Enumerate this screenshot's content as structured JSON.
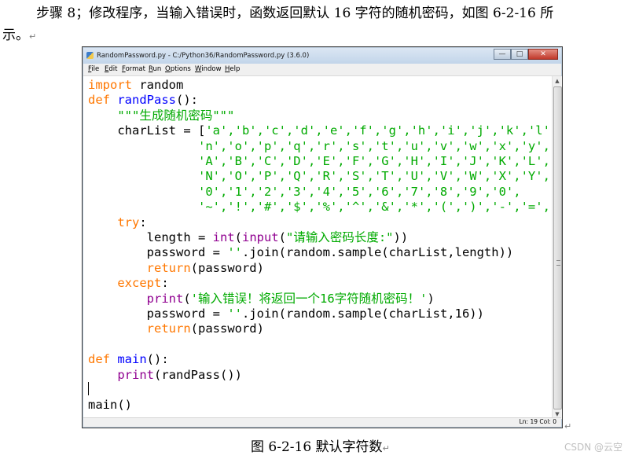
{
  "paragraph": {
    "line1": "步骤 8；修改程序，当输入错误时，函数返回默认 16 字符的随机密码，如图 6-2-16 所",
    "line2": "示。"
  },
  "paragraph_mark": "↵",
  "window": {
    "title": "RandomPassword.py - C:/Python36/RandomPassword.py (3.6.0)",
    "btn_min": "—",
    "btn_max": "□",
    "btn_close": "✕",
    "menu": [
      "File",
      "Edit",
      "Format",
      "Run",
      "Options",
      "Window",
      "Help"
    ],
    "status": "Ln: 19  Col: 0"
  },
  "code": [
    [
      {
        "t": "import",
        "c": "kw"
      },
      {
        "t": " random"
      }
    ],
    [
      {
        "t": "def",
        "c": "kw"
      },
      {
        "t": " "
      },
      {
        "t": "randPass",
        "c": "def"
      },
      {
        "t": "():"
      }
    ],
    [
      {
        "t": "    "
      },
      {
        "t": "\"\"\"生成随机密码\"\"\"",
        "c": "str"
      }
    ],
    [
      {
        "t": "    charList = ["
      },
      {
        "t": "'a','b','c','d','e','f','g','h','i','j','k','l','m',",
        "c": "str"
      }
    ],
    [
      {
        "t": "               "
      },
      {
        "t": "'n','o','p','q','r','s','t','u','v','w','x','y','z',",
        "c": "str"
      }
    ],
    [
      {
        "t": "               "
      },
      {
        "t": "'A','B','C','D','E','F','G','H','I','J','K','L','M',",
        "c": "str"
      }
    ],
    [
      {
        "t": "               "
      },
      {
        "t": "'N','O','P','Q','R','S','T','U','V','W','X','Y','Z',",
        "c": "str"
      }
    ],
    [
      {
        "t": "               "
      },
      {
        "t": "'0','1','2','3','4','5','6','7','8','9','0',",
        "c": "str"
      }
    ],
    [
      {
        "t": "               "
      },
      {
        "t": "'~','!','#','$','%','^','&','*','(',')','-','=','+',",
        "c": "str"
      }
    ],
    [
      {
        "t": "    "
      },
      {
        "t": "try",
        "c": "kw"
      },
      {
        "t": ":"
      }
    ],
    [
      {
        "t": "        length = "
      },
      {
        "t": "int",
        "c": "bi"
      },
      {
        "t": "("
      },
      {
        "t": "input",
        "c": "bi"
      },
      {
        "t": "("
      },
      {
        "t": "\"请输入密码长度:\"",
        "c": "str"
      },
      {
        "t": "))"
      }
    ],
    [
      {
        "t": "        password = "
      },
      {
        "t": "''",
        "c": "str"
      },
      {
        "t": ".join(random.sample(charList,length))"
      }
    ],
    [
      {
        "t": "        "
      },
      {
        "t": "return",
        "c": "kw"
      },
      {
        "t": "(password)"
      }
    ],
    [
      {
        "t": "    "
      },
      {
        "t": "except",
        "c": "kw"
      },
      {
        "t": ":"
      }
    ],
    [
      {
        "t": "        "
      },
      {
        "t": "print",
        "c": "bi"
      },
      {
        "t": "("
      },
      {
        "t": "'输入错误！将返回一个16字符随机密码！'",
        "c": "str"
      },
      {
        "t": ")"
      }
    ],
    [
      {
        "t": "        password = "
      },
      {
        "t": "''",
        "c": "str"
      },
      {
        "t": ".join(random.sample(charList,16))"
      }
    ],
    [
      {
        "t": "        "
      },
      {
        "t": "return",
        "c": "kw"
      },
      {
        "t": "(password)"
      }
    ],
    [
      {
        "t": ""
      }
    ],
    [
      {
        "t": "def",
        "c": "kw"
      },
      {
        "t": " "
      },
      {
        "t": "main",
        "c": "def"
      },
      {
        "t": "():"
      }
    ],
    [
      {
        "t": "    "
      },
      {
        "t": "print",
        "c": "bi"
      },
      {
        "t": "(randPass())"
      }
    ],
    [
      {
        "t": ""
      }
    ],
    [
      {
        "t": "main()"
      }
    ]
  ],
  "caption": "图 6-2-16  默认字符数",
  "watermark": "CSDN @云空"
}
